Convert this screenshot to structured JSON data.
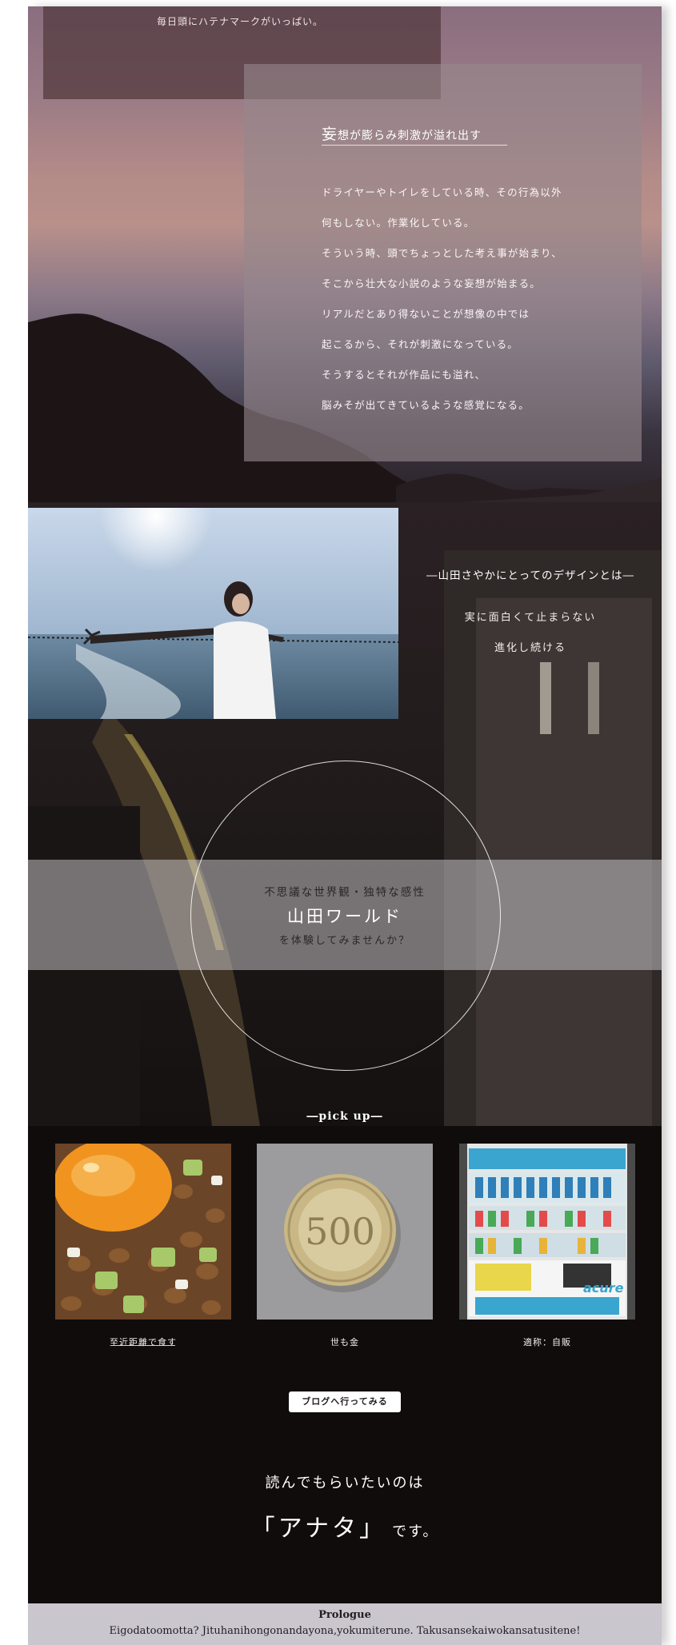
{
  "top_text": "毎日頭にハテナマークがいっぱい。",
  "delusion": {
    "title_first": "妄",
    "title_rest": "想が膨らみ刺激が溢れ出す",
    "lines": [
      "ドライヤーやトイレをしている時、その行為以外",
      "何もしない。作業化している。",
      "そういう時、頭でちょっとした考え事が始まり、",
      "そこから壮大な小説のような妄想が始まる。",
      "リアルだとあり得ないことが想像の中では",
      "起こるから、それが刺激になっている。",
      "そうするとそれが作品にも溢れ、",
      "脳みそが出てきているような感覚になる。"
    ]
  },
  "design": {
    "heading": "―山田さやかにとってのデザインとは―",
    "line1": "実に面白くて止まらない",
    "line2": "進化し続ける"
  },
  "world": {
    "line1": "不思議な世界観・独特な感性",
    "title": "山田ワールド",
    "line3": "を体験してみませんか？"
  },
  "pickup": {
    "heading": "―pick up―",
    "cards": [
      {
        "caption": "至近距離で食す"
      },
      {
        "caption": "世も金",
        "coin_text": "500"
      },
      {
        "caption": "適称：自販",
        "machine_brand": "acure"
      }
    ],
    "blog_button": "ブログへ行ってみる"
  },
  "closing": {
    "line1": "読んでもらいたいのは",
    "anata": "「アナタ」",
    "desu": "です。"
  },
  "footer": {
    "title": "Prologue",
    "text": "Eigodatoomotta?  Jituhanihongonandayona,yokumiterune.  Takusansekaiwokansatusitene!"
  },
  "colors": {
    "page_background": "#100c0b",
    "footer_background": "#c9c6ce",
    "button_background": "#ffffff"
  }
}
